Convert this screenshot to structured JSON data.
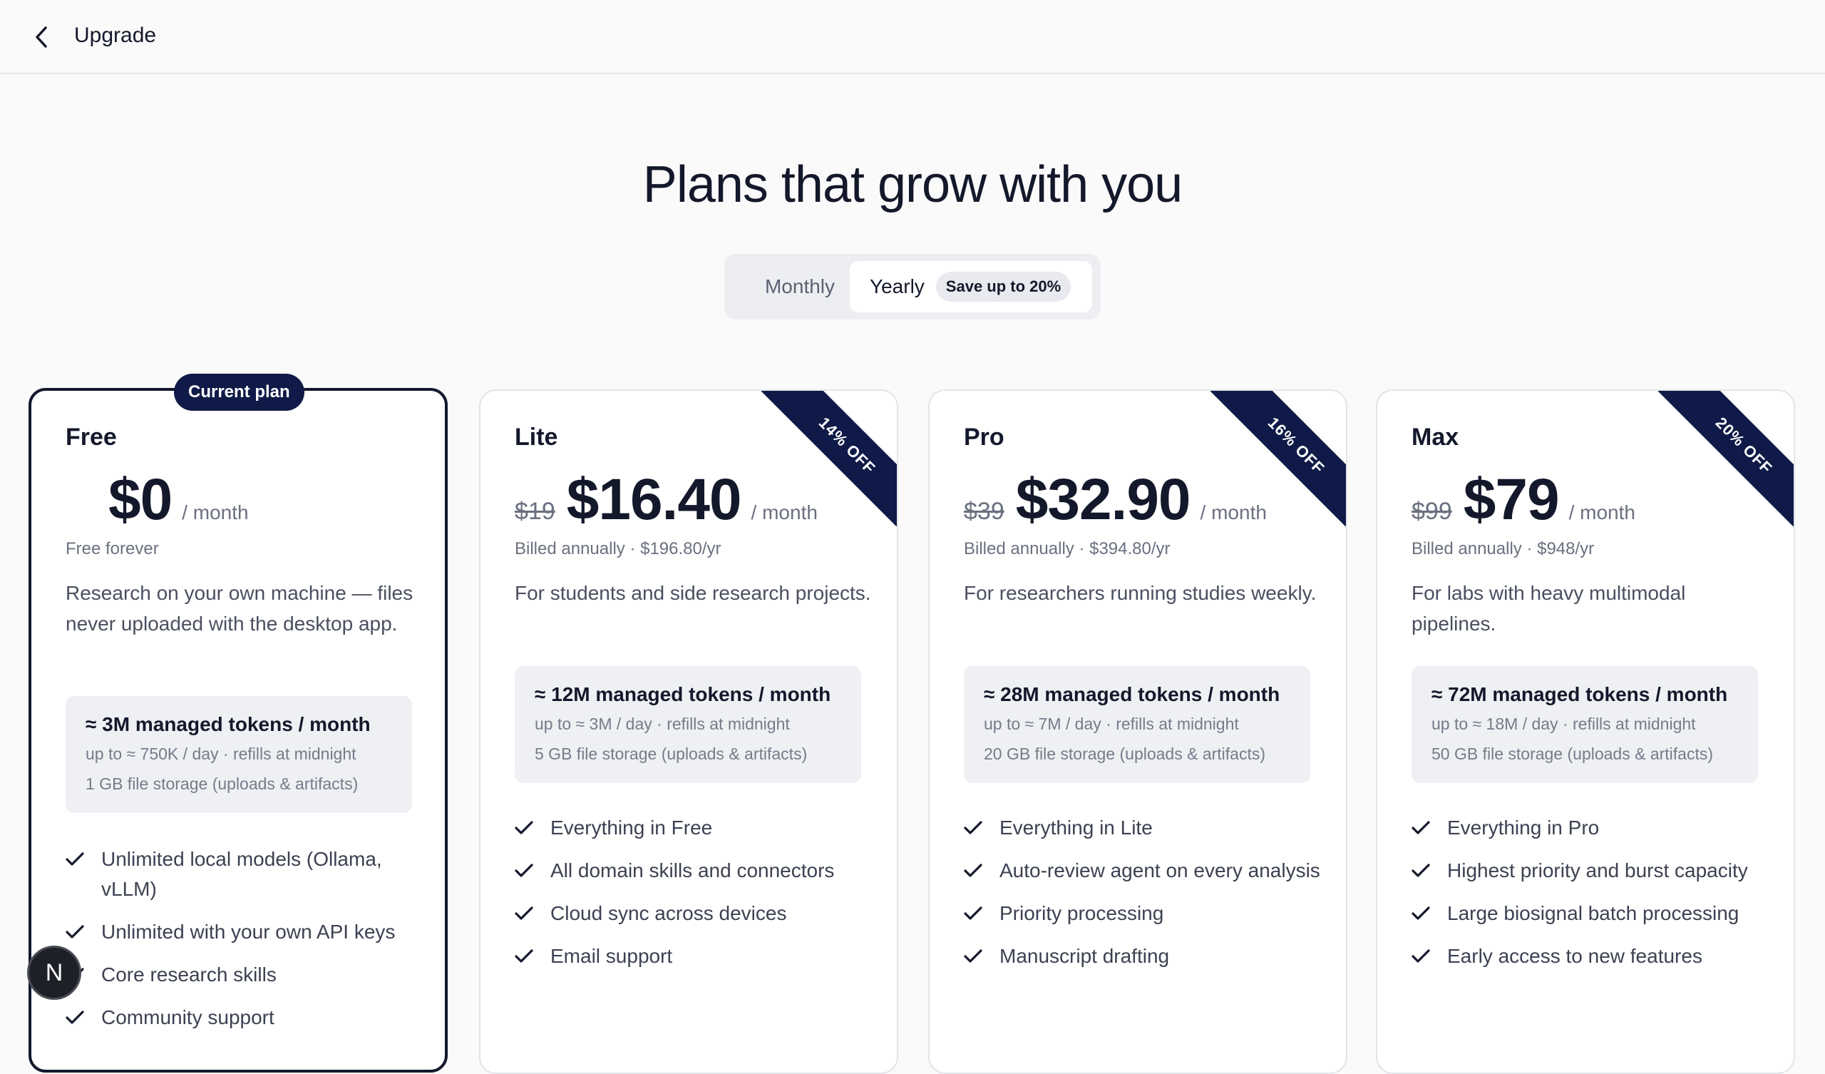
{
  "header": {
    "title": "Upgrade",
    "back_icon": "chevron-left-icon"
  },
  "headline": "Plans that grow with you",
  "billing_toggle": {
    "monthly_label": "Monthly",
    "yearly_label": "Yearly",
    "save_badge": "Save up to 20%",
    "selected": "Yearly"
  },
  "plans": [
    {
      "name": "Free",
      "badge": "Current plan",
      "old_price": "",
      "price": "$0",
      "per": "/ month",
      "billing": "Free forever",
      "description": "Research on your own machine — files never uploaded with the desktop app.",
      "tokens": {
        "title": "≈ 3M managed tokens / month",
        "daily": "up to ≈ 750K / day · refills at midnight",
        "storage": "1 GB file storage (uploads & artifacts)"
      },
      "features": [
        "Unlimited local models (Ollama, vLLM)",
        "Unlimited with your own API keys",
        "Core research skills",
        "Community support"
      ]
    },
    {
      "name": "Lite",
      "ribbon": "14% OFF",
      "old_price": "$19",
      "price": "$16.40",
      "per": "/ month",
      "billing": "Billed annually · $196.80/yr",
      "description": "For students and side research projects.",
      "tokens": {
        "title": "≈ 12M managed tokens / month",
        "daily": "up to ≈ 3M / day · refills at midnight",
        "storage": "5 GB file storage (uploads & artifacts)"
      },
      "features": [
        "Everything in Free",
        "All domain skills and connectors",
        "Cloud sync across devices",
        "Email support"
      ]
    },
    {
      "name": "Pro",
      "ribbon": "16% OFF",
      "old_price": "$39",
      "price": "$32.90",
      "per": "/ month",
      "billing": "Billed annually · $394.80/yr",
      "description": "For researchers running studies weekly.",
      "tokens": {
        "title": "≈ 28M managed tokens / month",
        "daily": "up to ≈ 7M / day · refills at midnight",
        "storage": "20 GB file storage (uploads & artifacts)"
      },
      "features": [
        "Everything in Lite",
        "Auto-review agent on every analysis",
        "Priority processing",
        "Manuscript drafting"
      ]
    },
    {
      "name": "Max",
      "ribbon": "20% OFF",
      "old_price": "$99",
      "price": "$79",
      "per": "/ month",
      "billing": "Billed annually · $948/yr",
      "description": "For labs with heavy multimodal pipelines.",
      "tokens": {
        "title": "≈ 72M managed tokens / month",
        "daily": "up to ≈ 18M / day · refills at midnight",
        "storage": "50 GB file storage (uploads & artifacts)"
      },
      "features": [
        "Everything in Pro",
        "Highest priority and burst capacity",
        "Large biosignal batch processing",
        "Early access to new features"
      ]
    }
  ],
  "avatar": {
    "initial": "N"
  },
  "colors": {
    "accent": "#101a48",
    "text": "#14182b",
    "muted": "#6b7080",
    "token_box": "#eef0f3"
  }
}
